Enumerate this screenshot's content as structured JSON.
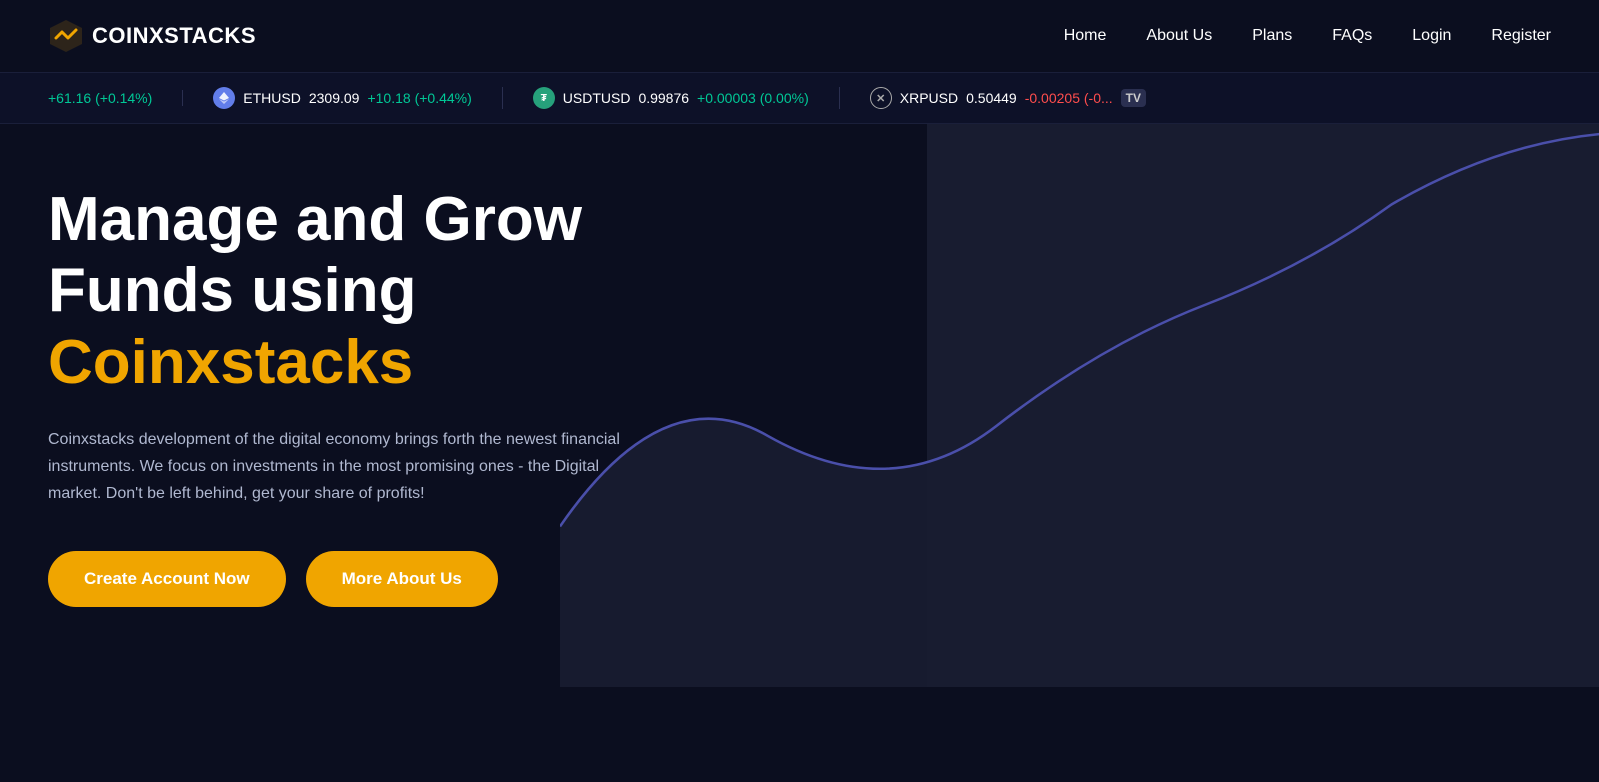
{
  "brand": {
    "name": "COINXSTACKS"
  },
  "nav": {
    "items": [
      {
        "label": "Home",
        "id": "home"
      },
      {
        "label": "About Us",
        "id": "about"
      },
      {
        "label": "Plans",
        "id": "plans"
      },
      {
        "label": "FAQs",
        "id": "faqs"
      },
      {
        "label": "Login",
        "id": "login"
      },
      {
        "label": "Register",
        "id": "register"
      }
    ]
  },
  "ticker": {
    "items": [
      {
        "id": "btc",
        "symbol": "",
        "change": "+61.16 (+0.14%)",
        "changeClass": "positive"
      },
      {
        "id": "eth",
        "symbol": "ETHUSD",
        "price": "2309.09",
        "change": "+10.18 (+0.44%)",
        "changeClass": "positive",
        "iconType": "eth"
      },
      {
        "id": "usdt",
        "symbol": "USDTUSD",
        "price": "0.99876",
        "change": "+0.00003 (0.00%)",
        "changeClass": "positive",
        "iconType": "usdt"
      },
      {
        "id": "xrp",
        "symbol": "XRPUSD",
        "price": "0.50449",
        "change": "-0.00205 (-0...",
        "changeClass": "negative",
        "iconType": "xrp"
      }
    ]
  },
  "hero": {
    "title_line1": "Manage and Grow",
    "title_line2": "Funds using",
    "title_accent": "Coinxstacks",
    "description": "Coinxstacks development of the digital economy brings forth the newest financial instruments. We focus on investments in the most promising ones - the Digital market. Don't be left behind, get your share of profits!",
    "btn_primary": "Create Account Now",
    "btn_secondary": "More About Us"
  }
}
